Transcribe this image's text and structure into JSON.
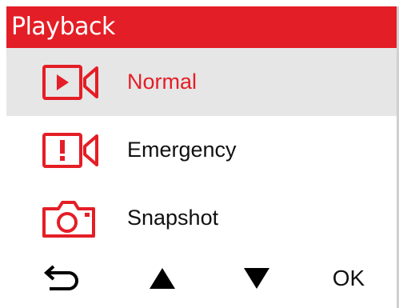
{
  "header": {
    "title": "Playback"
  },
  "menu": {
    "items": [
      {
        "label": "Normal",
        "icon": "video-play-icon",
        "selected": true
      },
      {
        "label": "Emergency",
        "icon": "video-emergency-icon",
        "selected": false
      },
      {
        "label": "Snapshot",
        "icon": "camera-icon",
        "selected": false
      }
    ]
  },
  "footer": {
    "back_icon": "return-arrow-icon",
    "up_icon": "triangle-up-icon",
    "down_icon": "triangle-down-icon",
    "ok_label": "OK"
  },
  "colors": {
    "accent": "#e41e26",
    "selected_background": "#e6e6e6",
    "text": "#111111",
    "background": "#ffffff"
  }
}
